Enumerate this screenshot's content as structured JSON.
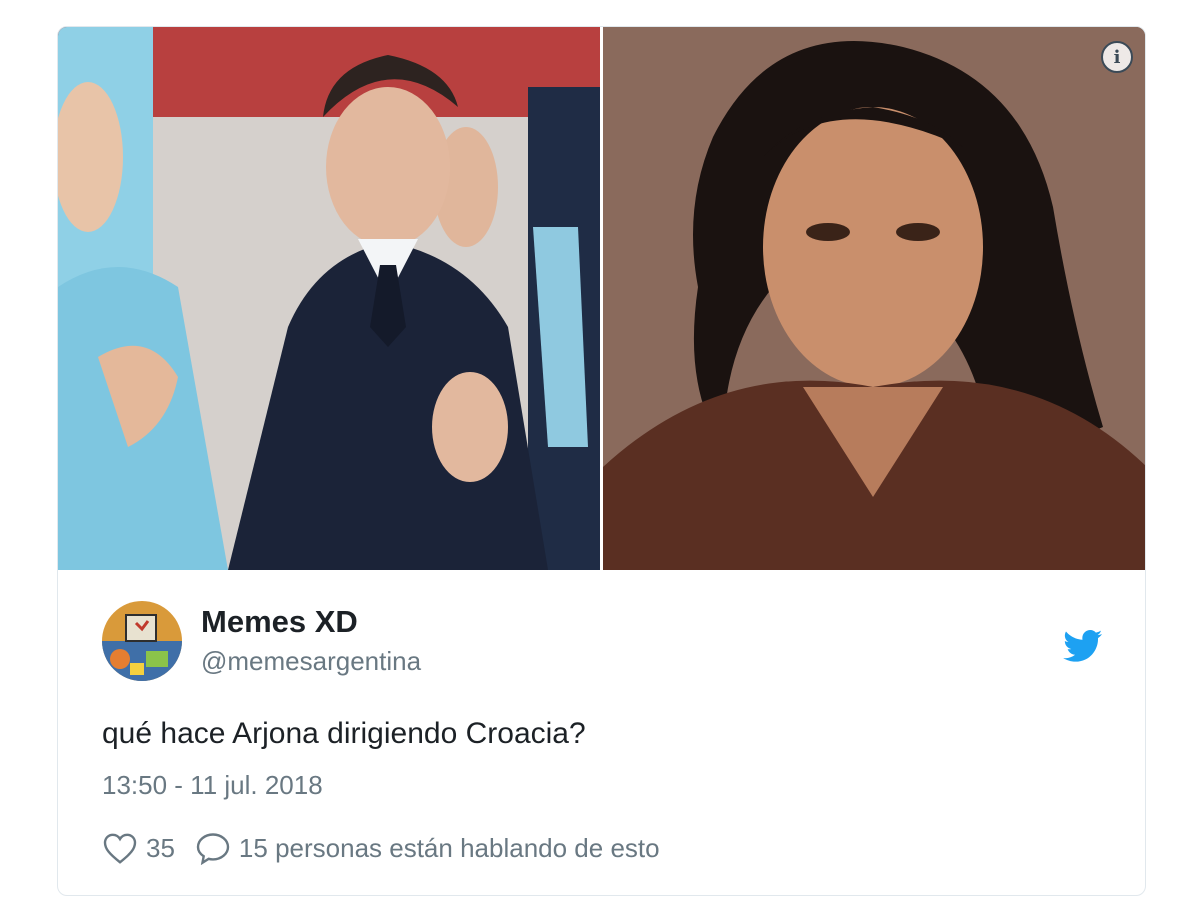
{
  "tweet": {
    "display_name": "Memes XD",
    "handle": "@memesargentina",
    "text": "qué hace Arjona dirigiendo Croacia?",
    "timestamp": "13:50 - 11 jul. 2018",
    "likes": "35",
    "conversation_text": "15 personas están hablando de esto"
  },
  "icons": {
    "info": "info-icon",
    "brand": "twitter-bird-icon",
    "like": "heart-outline-icon",
    "reply": "speech-bubble-icon"
  },
  "colors": {
    "brand": "#1da1f2",
    "text": "#1c2126",
    "muted": "#697882",
    "border": "#e1e8ed"
  }
}
